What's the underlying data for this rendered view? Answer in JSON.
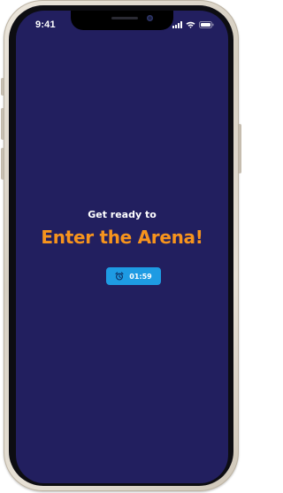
{
  "status_bar": {
    "time": "9:41",
    "icons": [
      "signal-icon",
      "wifi-icon",
      "battery-icon"
    ]
  },
  "main": {
    "subtitle": "Get ready to",
    "title": "Enter the Arena!",
    "timer": {
      "icon": "alarm-clock-icon",
      "value": "01:59"
    }
  },
  "colors": {
    "background": "#221f5f",
    "title": "#f7941d",
    "subtitle": "#ffffff",
    "timer_badge": "#1e9be3"
  }
}
